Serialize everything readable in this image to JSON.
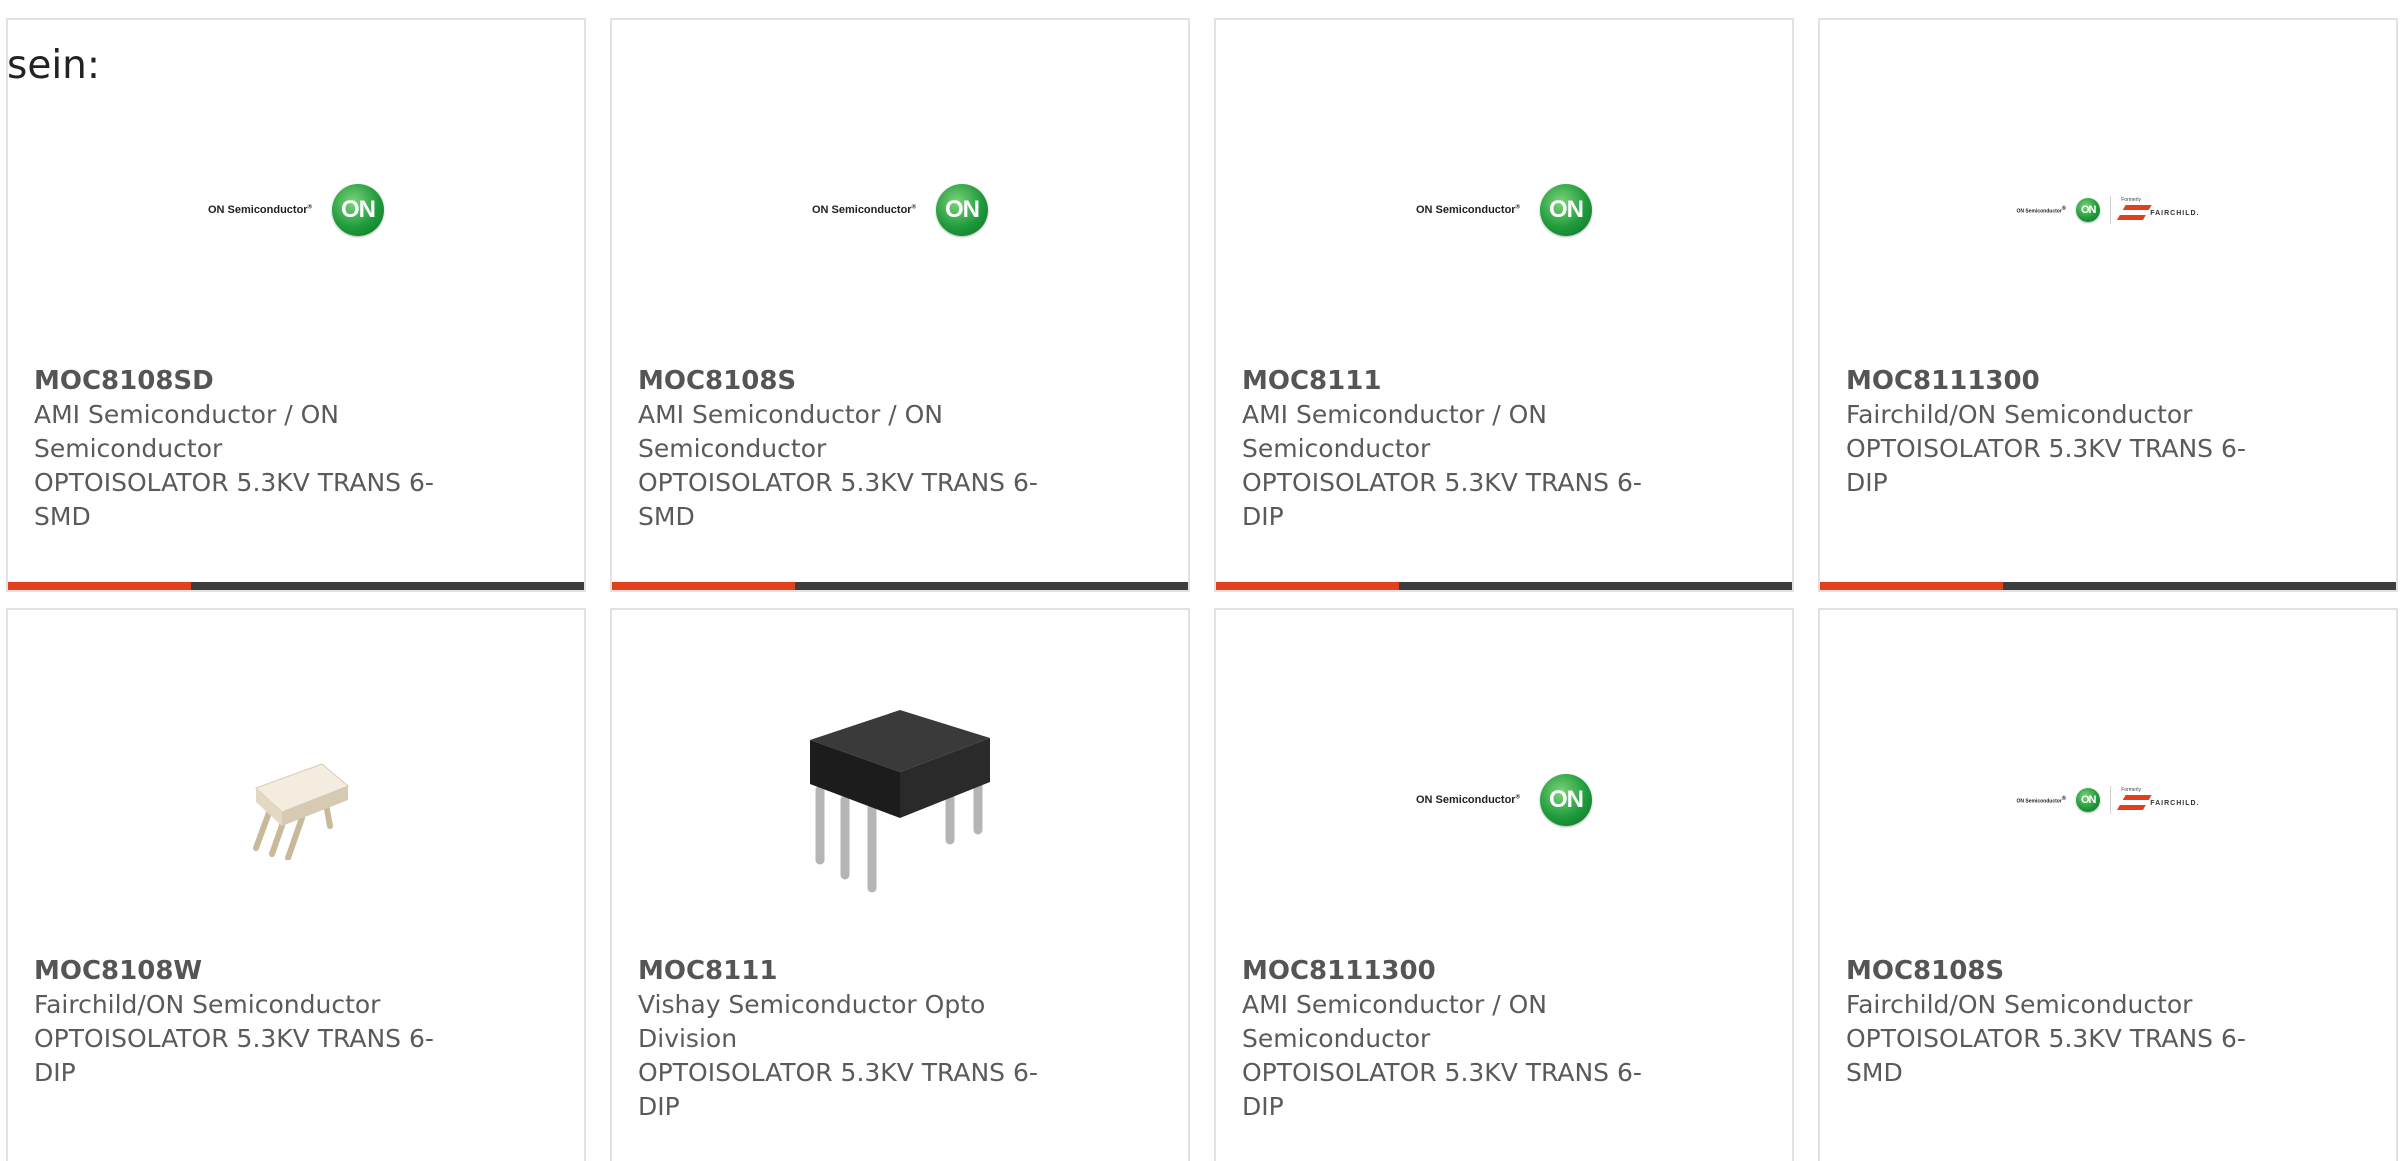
{
  "intro_text": "sein:",
  "colors": {
    "accent": "#e0411c",
    "bar_dark": "#3d3d3d",
    "card_border": "#e2e2e2",
    "on_green": "#1f9b3c"
  },
  "logo": {
    "on_text": "ON Semiconductor",
    "on_badge": "ON",
    "formerly": "Formerly",
    "fairchild": "FAIRCHILD."
  },
  "cards": [
    {
      "part": "MOC8108SD",
      "manufacturer": "AMI Semiconductor / ON Semiconductor",
      "description": "OPTOISOLATOR 5.3KV TRANS 6-SMD",
      "image": "on-semiconductor-logo"
    },
    {
      "part": "MOC8108S",
      "manufacturer": "AMI Semiconductor / ON Semiconductor",
      "description": "OPTOISOLATOR 5.3KV TRANS 6-SMD",
      "image": "on-semiconductor-logo"
    },
    {
      "part": "MOC8111",
      "manufacturer": "AMI Semiconductor / ON Semiconductor",
      "description": "OPTOISOLATOR 5.3KV TRANS 6-DIP",
      "image": "on-semiconductor-logo"
    },
    {
      "part": "MOC8111300",
      "manufacturer": "Fairchild/ON Semiconductor",
      "description": "OPTOISOLATOR 5.3KV TRANS 6-DIP",
      "image": "on-fairchild-logo"
    },
    {
      "part": "MOC8108W",
      "manufacturer": "Fairchild/ON Semiconductor",
      "description": "OPTOISOLATOR 5.3KV TRANS 6-DIP",
      "image": "white-dip-chip-photo"
    },
    {
      "part": "MOC8111",
      "manufacturer": "Vishay Semiconductor Opto Division",
      "description": "OPTOISOLATOR 5.3KV TRANS 6-DIP",
      "image": "black-dip-chip-photo"
    },
    {
      "part": "MOC8111300",
      "manufacturer": "AMI Semiconductor / ON Semiconductor",
      "description": "OPTOISOLATOR 5.3KV TRANS 6-DIP",
      "image": "on-semiconductor-logo"
    },
    {
      "part": "MOC8108S",
      "manufacturer": "Fairchild/ON Semiconductor",
      "description": "OPTOISOLATOR 5.3KV TRANS 6-SMD",
      "image": "on-fairchild-logo"
    }
  ]
}
